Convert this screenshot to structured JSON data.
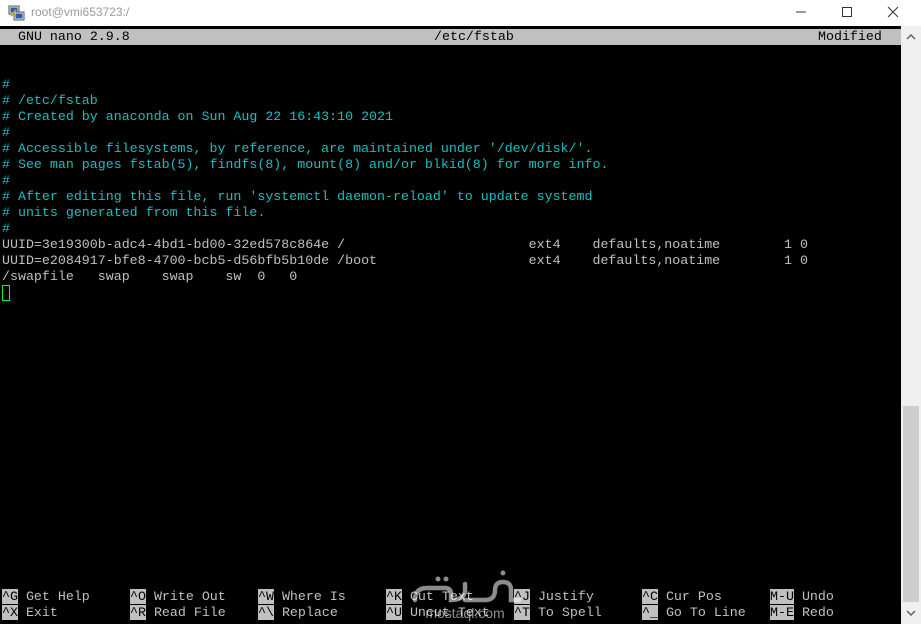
{
  "window": {
    "title": "root@vmi653723:/"
  },
  "nano": {
    "version": "GNU nano 2.9.8",
    "filename": "/etc/fstab",
    "status": "Modified"
  },
  "file_lines": [
    {
      "kind": "comment",
      "text": "#"
    },
    {
      "kind": "comment",
      "text": "# /etc/fstab"
    },
    {
      "kind": "comment",
      "text": "# Created by anaconda on Sun Aug 22 16:43:10 2021"
    },
    {
      "kind": "comment",
      "text": "#"
    },
    {
      "kind": "comment",
      "text": "# Accessible filesystems, by reference, are maintained under '/dev/disk/'."
    },
    {
      "kind": "comment",
      "text": "# See man pages fstab(5), findfs(8), mount(8) and/or blkid(8) for more info."
    },
    {
      "kind": "comment",
      "text": "#"
    },
    {
      "kind": "comment",
      "text": "# After editing this file, run 'systemctl daemon-reload' to update systemd"
    },
    {
      "kind": "comment",
      "text": "# units generated from this file."
    },
    {
      "kind": "comment",
      "text": "#"
    },
    {
      "kind": "plain",
      "text": "UUID=3e19300b-adc4-4bd1-bd00-32ed578c864e /                       ext4    defaults,noatime        1 0"
    },
    {
      "kind": "plain",
      "text": "UUID=e2084917-bfe8-4700-bcb5-d56bfb5b10de /boot                   ext4    defaults,noatime        1 0"
    },
    {
      "kind": "plain",
      "text": "/swapfile   swap    swap    sw  0   0"
    }
  ],
  "shortcuts": [
    [
      {
        "key": "^G",
        "label": "Get Help"
      },
      {
        "key": "^X",
        "label": "Exit"
      }
    ],
    [
      {
        "key": "^O",
        "label": "Write Out"
      },
      {
        "key": "^R",
        "label": "Read File"
      }
    ],
    [
      {
        "key": "^W",
        "label": "Where Is"
      },
      {
        "key": "^\\",
        "label": "Replace"
      }
    ],
    [
      {
        "key": "^K",
        "label": "Cut Text"
      },
      {
        "key": "^U",
        "label": "Uncut Text"
      }
    ],
    [
      {
        "key": "^J",
        "label": "Justify"
      },
      {
        "key": "^T",
        "label": "To Spell"
      }
    ],
    [
      {
        "key": "^C",
        "label": "Cur Pos"
      },
      {
        "key": "^_",
        "label": "Go To Line"
      }
    ],
    [
      {
        "key": "M-U",
        "label": "Undo"
      },
      {
        "key": "M-E",
        "label": "Redo"
      }
    ]
  ],
  "watermark": {
    "text": "mostaql.com"
  },
  "colors": {
    "comment": "#18c0c0",
    "text": "#c0c0c0",
    "background": "#000000",
    "header": "#c0c0c0",
    "cursor": "#00ff40"
  }
}
